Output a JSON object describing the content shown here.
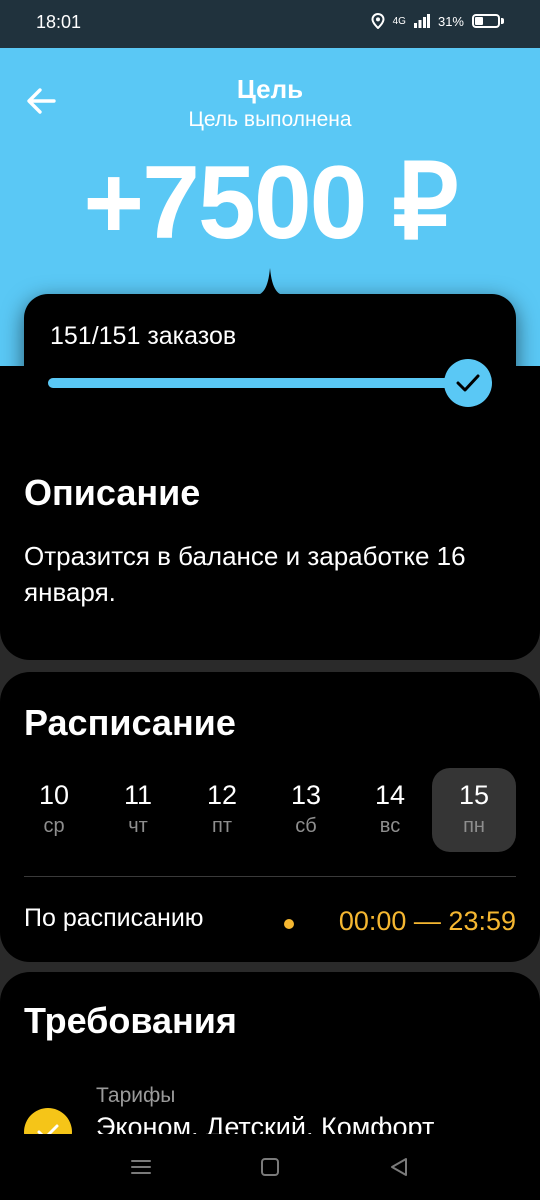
{
  "status_bar": {
    "time": "18:01",
    "network": "4G",
    "battery": "31%"
  },
  "header": {
    "title": "Цель",
    "subtitle": "Цель выполнена",
    "amount": "+7500 ₽",
    "accent_color": "#5ac8f5"
  },
  "progress": {
    "text": "151/151 заказов",
    "done": 151,
    "total": 151,
    "fraction": 1.0
  },
  "description": {
    "title": "Описание",
    "text": "Отразится в балансе и заработке 16 января."
  },
  "schedule": {
    "title": "Расписание",
    "days": [
      {
        "num": "10",
        "weekday": "ср",
        "selected": false
      },
      {
        "num": "11",
        "weekday": "чт",
        "selected": false
      },
      {
        "num": "12",
        "weekday": "пт",
        "selected": false
      },
      {
        "num": "13",
        "weekday": "сб",
        "selected": false
      },
      {
        "num": "14",
        "weekday": "вс",
        "selected": false
      },
      {
        "num": "15",
        "weekday": "пн",
        "selected": true
      }
    ],
    "label": "По расписанию",
    "time": "00:00 — 23:59",
    "time_color": "#f5b731"
  },
  "requirements": {
    "title": "Требования",
    "tariffs_label": "Тарифы",
    "tariffs_value": "Эконом, Детский, Комфорт"
  },
  "icons": {
    "back": "arrow-left-icon",
    "check": "checkmark-icon",
    "nav": [
      "menu-icon",
      "home-icon",
      "back-triangle-icon"
    ]
  }
}
